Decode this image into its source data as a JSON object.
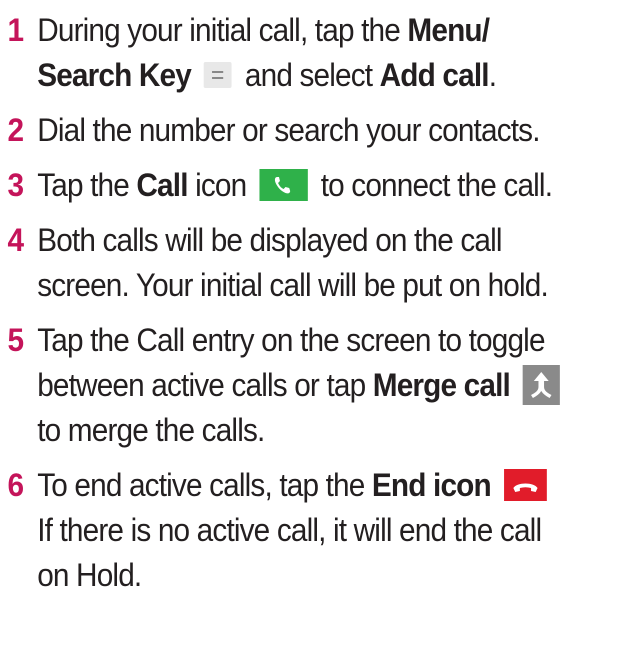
{
  "steps": [
    {
      "number": "1",
      "t1": "During your initial call, tap the ",
      "b1": "Menu/",
      "b2": "Search Key",
      "t2": " and select ",
      "b3": "Add call",
      "t3": "."
    },
    {
      "number": "2",
      "t1": "Dial the number or search your contacts."
    },
    {
      "number": "3",
      "t1": "Tap the ",
      "b1": "Call",
      "t2": " icon",
      "t3": " to connect the call."
    },
    {
      "number": "4",
      "t1": "Both calls will be displayed on the call",
      "t2": "screen. Your initial call will be put on hold."
    },
    {
      "number": "5",
      "t1": "Tap the Call entry on the screen to toggle",
      "t2": "between active calls or tap ",
      "b1": "Merge call",
      "t3": "to merge the calls."
    },
    {
      "number": "6",
      "t1": "To end active calls, tap the ",
      "b1": "End icon",
      "t2": "If there is no active call, it will end the call",
      "t3": "on Hold."
    }
  ],
  "icons": {
    "menu": "menu-icon",
    "call": "phone-icon",
    "merge": "merge-call-icon",
    "end": "end-call-icon"
  },
  "colors": {
    "number": "#c4145a",
    "text": "#231f20",
    "call_icon_bg": "#2fb14a",
    "merge_icon_bg": "#8a8a8a",
    "end_icon_bg": "#e11c2a"
  }
}
